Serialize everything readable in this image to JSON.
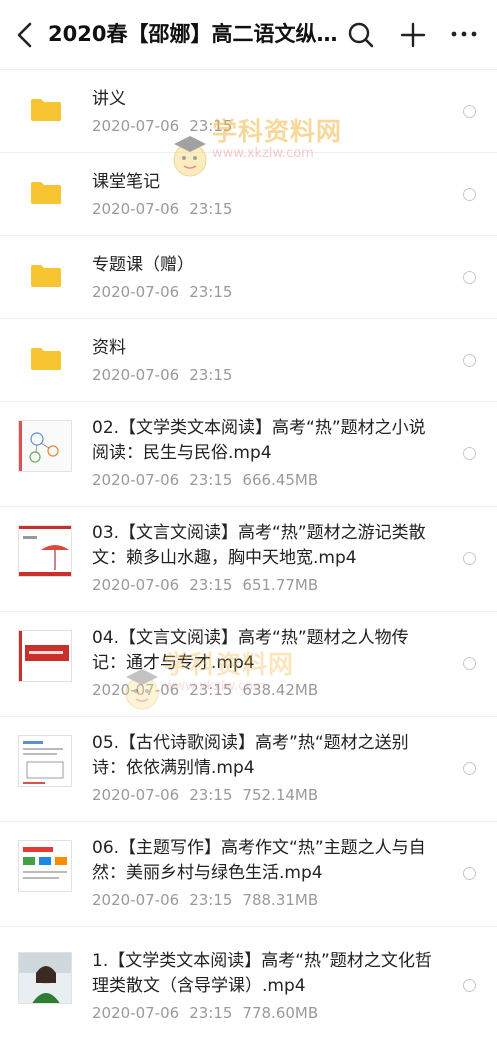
{
  "header": {
    "title": "2020春【邵娜】高二语文纵…"
  },
  "watermark": {
    "title": "学科资料网",
    "url": "www.xkzlw.com"
  },
  "files": [
    {
      "type": "folder",
      "name": "讲义",
      "date": "2020-07-06",
      "time": "23:15",
      "size": ""
    },
    {
      "type": "folder",
      "name": "课堂笔记",
      "date": "2020-07-06",
      "time": "23:15",
      "size": ""
    },
    {
      "type": "folder",
      "name": "专题课（赠）",
      "date": "2020-07-06",
      "time": "23:15",
      "size": ""
    },
    {
      "type": "folder",
      "name": "资料",
      "date": "2020-07-06",
      "time": "23:15",
      "size": ""
    },
    {
      "type": "video",
      "name": "02.【文学类文本阅读】高考“热”题材之小说阅读：民生与民俗.mp4",
      "date": "2020-07-06",
      "time": "23:15",
      "size": "666.45MB"
    },
    {
      "type": "video",
      "name": "03.【文言文阅读】高考“热”题材之游记类散文：赖多山水趣，胸中天地宽.mp4",
      "date": "2020-07-06",
      "time": "23:15",
      "size": "651.77MB"
    },
    {
      "type": "video",
      "name": "04.【文言文阅读】高考“热”题材之人物传记：通才与专才.mp4",
      "date": "2020-07-06",
      "time": "23:15",
      "size": "638.42MB"
    },
    {
      "type": "video",
      "name": "05.【古代诗歌阅读】高考”热“题材之送别诗：依依满别情.mp4",
      "date": "2020-07-06",
      "time": "23:15",
      "size": "752.14MB"
    },
    {
      "type": "video",
      "name": "06.【主题写作】高考作文“热”主题之人与自然：美丽乡村与绿色生活.mp4",
      "date": "2020-07-06",
      "time": "23:15",
      "size": "788.31MB"
    },
    {
      "type": "video",
      "name": "1.【文学类文本阅读】高考“热”题材之文化哲理类散文（含导学课）.mp4",
      "date": "2020-07-06",
      "time": "23:15",
      "size": "778.60MB"
    }
  ],
  "colors": {
    "folder": "#f7c531",
    "meta_text": "#9a9a9a",
    "title_text": "#111111"
  }
}
